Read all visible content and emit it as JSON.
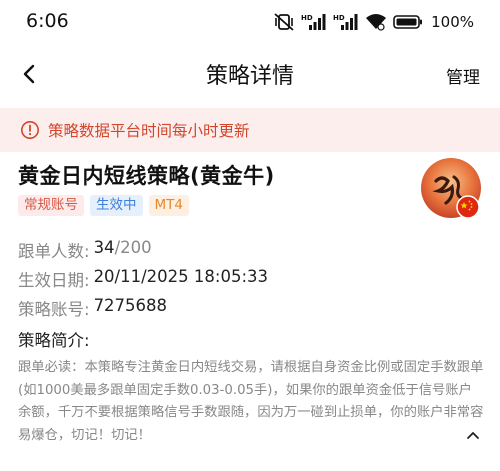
{
  "status_bar": {
    "time": "6:06",
    "battery_percent": "100%",
    "network_1": "HD",
    "network_2": "HD",
    "icons": [
      "mute-vibrate-icon",
      "signal-icon",
      "signal-icon",
      "wifi-icon",
      "battery-icon"
    ]
  },
  "nav": {
    "title": "策略详情",
    "manage_label": "管理"
  },
  "notice": {
    "text": "策略数据平台时间每小时更新",
    "color": "#d2472c",
    "background": "#fdeeee"
  },
  "strategy": {
    "name": "黄金日内短线策略(黄金牛)",
    "tags": {
      "account_type": "常规账号",
      "status": "生效中",
      "platform": "MT4"
    },
    "followers_label": "跟单人数:",
    "followers_count": "34",
    "followers_max": "/200",
    "effective_date_label": "生效日期:",
    "effective_date": "20/11/2025 18:05:33",
    "account_label": "策略账号:",
    "account_number": "7275688",
    "intro_title": "策略简介:",
    "intro_text": "跟单必读：本策略专注黄金日内短线交易，请根据自身资金比例或固定手数跟单(如1000美最多跟单固定手数0.03-0.05手)，如果你的跟单资金低于信号账户余额，千万不要根据策略信号手数跟随，因为万一碰到止损单，你的账户非常容易爆仓，切记！切记！"
  }
}
